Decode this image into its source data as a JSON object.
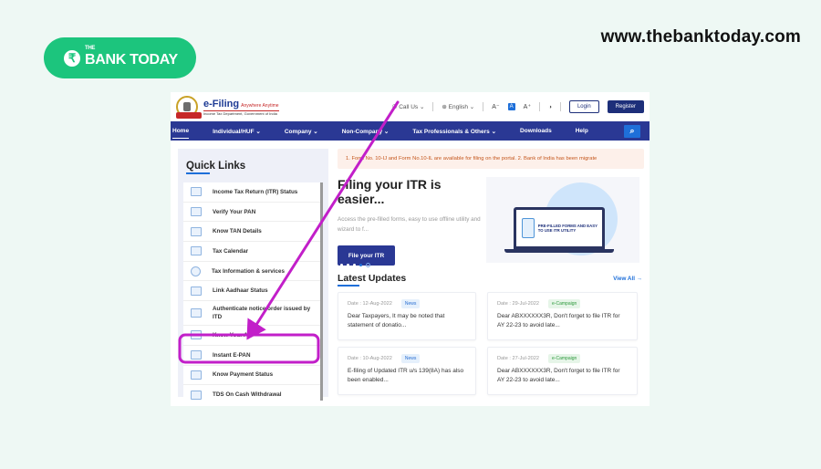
{
  "brand": {
    "the": "THE",
    "name": "BANK TODAY",
    "rupee_symbol": "₹",
    "url": "www.thebanktoday.com"
  },
  "portal": {
    "logo": {
      "title": "e-Filing",
      "tagline": "Anywhere Anytime",
      "subtitle": "Income Tax Department, Government of India"
    },
    "utility": {
      "call_us": "Call Us",
      "language": "English",
      "font_decrease": "A⁻",
      "font_normal": "A",
      "font_increase": "A⁺",
      "contrast_icon": "◑",
      "login": "Login",
      "register": "Register"
    },
    "nav": [
      {
        "label": "Home",
        "active": true
      },
      {
        "label": "Individual/HUF ⌄"
      },
      {
        "label": "Company ⌄"
      },
      {
        "label": "Non-Company ⌄"
      },
      {
        "label": "Tax Professionals & Others ⌄"
      },
      {
        "label": "Downloads"
      },
      {
        "label": "Help"
      }
    ],
    "search_icon": "⌕",
    "quick_links": {
      "title": "Quick Links",
      "items": [
        {
          "label": "Income Tax Return (ITR) Status",
          "icon": "itr-status-icon"
        },
        {
          "label": "Verify Your PAN",
          "icon": "pan-card-icon"
        },
        {
          "label": "Know TAN Details",
          "icon": "tan-details-icon"
        },
        {
          "label": "Tax Calendar",
          "icon": "calendar-icon"
        },
        {
          "label": "Tax Information & services",
          "icon": "info-icon"
        },
        {
          "label": "Link Aadhaar Status",
          "icon": "aadhaar-icon"
        },
        {
          "label": "Authenticate notice/order issued by ITD",
          "icon": "document-icon"
        },
        {
          "label": "Know Your AO",
          "icon": "officer-icon"
        },
        {
          "label": "Instant E-PAN",
          "icon": "epan-card-icon"
        },
        {
          "label": "Know Payment Status",
          "icon": "payment-icon"
        },
        {
          "label": "TDS On Cash Withdrawal",
          "icon": "tds-icon"
        }
      ]
    },
    "ticker": "1. Form No. 10-IJ and Form No.10-IL are available for filing on the portal. 2. Bank of India has been migrate",
    "hero": {
      "title": "Filing your ITR is easier...",
      "description": "Access the pre-filled forms, easy to use offline utility and wizard to f...",
      "button": "File your ITR",
      "image_text": "PRE-FILLED FORMS AND EASY TO USE ITR UTILITY"
    },
    "latest_updates": {
      "title": "Latest Updates",
      "view_all": "View All →",
      "cards": [
        {
          "date": "Date : 12-Aug-2022",
          "badge": "News",
          "type": "news",
          "text": "Dear Taxpayers, It may be noted that statement of donatio..."
        },
        {
          "date": "Date : 29-Jul-2022",
          "badge": "e-Campaign",
          "type": "camp",
          "text": "Dear ABXXXXXX3R, Don't forget to file ITR for AY 22-23 to avoid late..."
        },
        {
          "date": "Date : 10-Aug-2022",
          "badge": "News",
          "type": "news",
          "text": "E-filing of Updated ITR u/s 139(8A) has also been enabled..."
        },
        {
          "date": "Date : 27-Jul-2022",
          "badge": "e-Campaign",
          "type": "camp",
          "text": "Dear ABXXXXXX3R, Don't forget to file ITR for AY 22-23 to avoid late..."
        }
      ]
    }
  },
  "annotation": {
    "highlighted_item": "Instant E-PAN",
    "color": "#c21fc9"
  },
  "colors": {
    "brand_green": "#1cc57d",
    "nav_blue": "#2a3894",
    "accent_blue": "#1e6fd9",
    "ticker_orange": "#c4561c"
  }
}
